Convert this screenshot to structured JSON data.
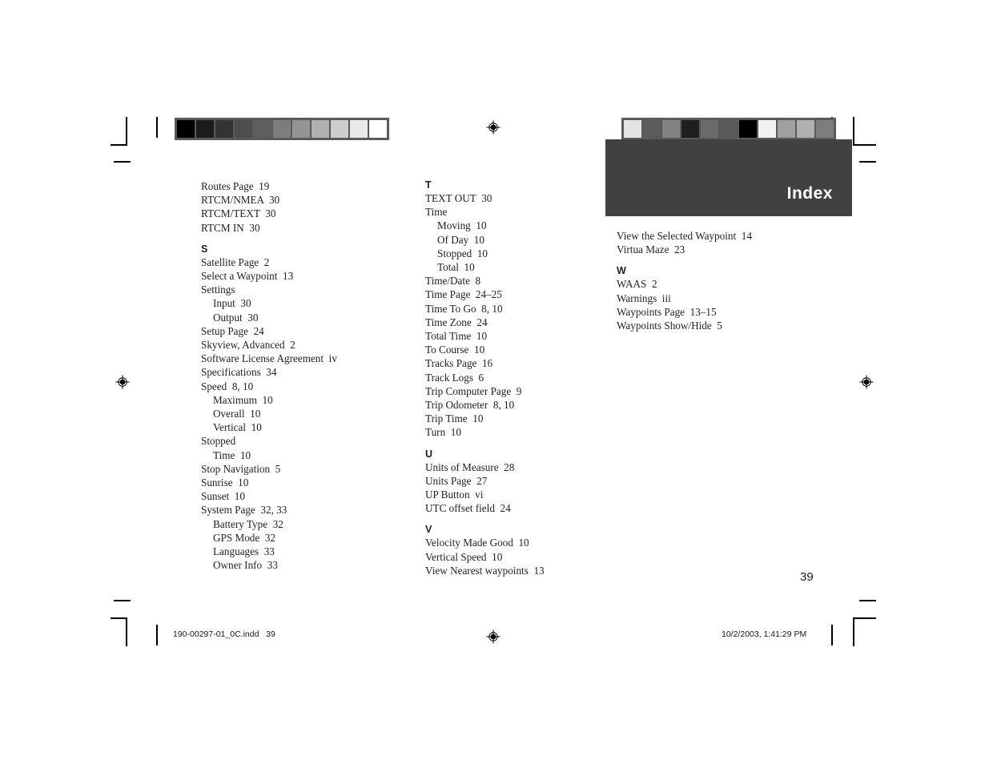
{
  "document": {
    "banner_title": "Index",
    "page_number": "39",
    "footer_left": "190-00297-01_0C.indd   39",
    "footer_right": "10/2/2003, 1:41:29 PM"
  },
  "colors": {
    "banner_bg": "#414141",
    "bar_frame": "#5a5a5a",
    "text": "#231f20"
  },
  "color_bars": {
    "left": [
      "#000000",
      "#1c1c1c",
      "#333333",
      "#4d4d4d",
      "#5e5e5e",
      "#7d7d7d",
      "#949494",
      "#b0b0b0",
      "#cccccc",
      "#e9e9e9",
      "#ffffff"
    ],
    "right": [
      "#e4e4e4",
      "#5c5c5c",
      "#828282",
      "#1f1f1f",
      "#6a6a6a",
      "#5a5a5a",
      "#000000",
      "#f2f2f2",
      "#a0a0a0",
      "#b0b0b0",
      "#7d7d7d"
    ]
  },
  "columns": [
    {
      "id": "col-1",
      "blocks": [
        {
          "type": "entries",
          "items": [
            {
              "text": "Routes Page  19",
              "sub": false
            },
            {
              "text": "RTCM/NMEA  30",
              "sub": false
            },
            {
              "text": "RTCM/TEXT  30",
              "sub": false
            },
            {
              "text": "RTCM IN  30",
              "sub": false
            }
          ]
        },
        {
          "type": "letter",
          "text": "S"
        },
        {
          "type": "entries",
          "items": [
            {
              "text": "Satellite Page  2",
              "sub": false
            },
            {
              "text": "Select a Waypoint  13",
              "sub": false
            },
            {
              "text": "Settings",
              "sub": false
            },
            {
              "text": "Input  30",
              "sub": true
            },
            {
              "text": "Output  30",
              "sub": true
            },
            {
              "text": "Setup Page  24",
              "sub": false
            },
            {
              "text": "Skyview, Advanced  2",
              "sub": false
            },
            {
              "text": "Software License Agreement  iv",
              "sub": false
            },
            {
              "text": "Specifications  34",
              "sub": false
            },
            {
              "text": "Speed  8, 10",
              "sub": false
            },
            {
              "text": "Maximum  10",
              "sub": true
            },
            {
              "text": "Overall  10",
              "sub": true
            },
            {
              "text": "Vertical  10",
              "sub": true
            },
            {
              "text": "Stopped",
              "sub": false
            },
            {
              "text": "Time  10",
              "sub": true
            },
            {
              "text": "Stop Navigation  5",
              "sub": false
            },
            {
              "text": "Sunrise  10",
              "sub": false
            },
            {
              "text": "Sunset  10",
              "sub": false
            },
            {
              "text": "System Page  32, 33",
              "sub": false
            },
            {
              "text": "Battery Type  32",
              "sub": true
            },
            {
              "text": "GPS Mode  32",
              "sub": true
            },
            {
              "text": "Languages  33",
              "sub": true
            },
            {
              "text": "Owner Info  33",
              "sub": true
            }
          ]
        }
      ]
    },
    {
      "id": "col-2",
      "blocks": [
        {
          "type": "letter",
          "text": "T",
          "first": true
        },
        {
          "type": "entries",
          "items": [
            {
              "text": "TEXT OUT  30",
              "sub": false
            },
            {
              "text": "Time",
              "sub": false
            },
            {
              "text": "Moving  10",
              "sub": true
            },
            {
              "text": "Of Day  10",
              "sub": true
            },
            {
              "text": "Stopped  10",
              "sub": true
            },
            {
              "text": "Total  10",
              "sub": true
            },
            {
              "text": "Time/Date  8",
              "sub": false
            },
            {
              "text": "Time Page  24–25",
              "sub": false
            },
            {
              "text": "Time To Go  8, 10",
              "sub": false
            },
            {
              "text": "Time Zone  24",
              "sub": false
            },
            {
              "text": "Total Time  10",
              "sub": false
            },
            {
              "text": "To Course  10",
              "sub": false
            },
            {
              "text": "Tracks Page  16",
              "sub": false
            },
            {
              "text": "Track Logs  6",
              "sub": false
            },
            {
              "text": "Trip Computer Page  9",
              "sub": false
            },
            {
              "text": "Trip Odometer  8, 10",
              "sub": false
            },
            {
              "text": "Trip Time  10",
              "sub": false
            },
            {
              "text": "Turn  10",
              "sub": false
            }
          ]
        },
        {
          "type": "letter",
          "text": "U"
        },
        {
          "type": "entries",
          "items": [
            {
              "text": "Units of Measure  28",
              "sub": false
            },
            {
              "text": "Units Page  27",
              "sub": false
            },
            {
              "text": "UP Button  vi",
              "sub": false
            },
            {
              "text": "UTC offset field  24",
              "sub": false
            }
          ]
        },
        {
          "type": "letter",
          "text": "V"
        },
        {
          "type": "entries",
          "items": [
            {
              "text": "Velocity Made Good  10",
              "sub": false
            },
            {
              "text": "Vertical Speed  10",
              "sub": false
            },
            {
              "text": "View Nearest waypoints  13",
              "sub": false
            }
          ]
        }
      ]
    },
    {
      "id": "col-3",
      "blocks": [
        {
          "type": "entries",
          "items": [
            {
              "text": "View the Selected Waypoint  14",
              "sub": false
            },
            {
              "text": "Virtua Maze  23",
              "sub": false
            }
          ]
        },
        {
          "type": "letter",
          "text": "W"
        },
        {
          "type": "entries",
          "items": [
            {
              "text": "WAAS  2",
              "sub": false
            },
            {
              "text": "Warnings  iii",
              "sub": false
            },
            {
              "text": "Waypoints Page  13–15",
              "sub": false
            },
            {
              "text": "Waypoints Show/Hide  5",
              "sub": false
            }
          ]
        }
      ]
    }
  ]
}
